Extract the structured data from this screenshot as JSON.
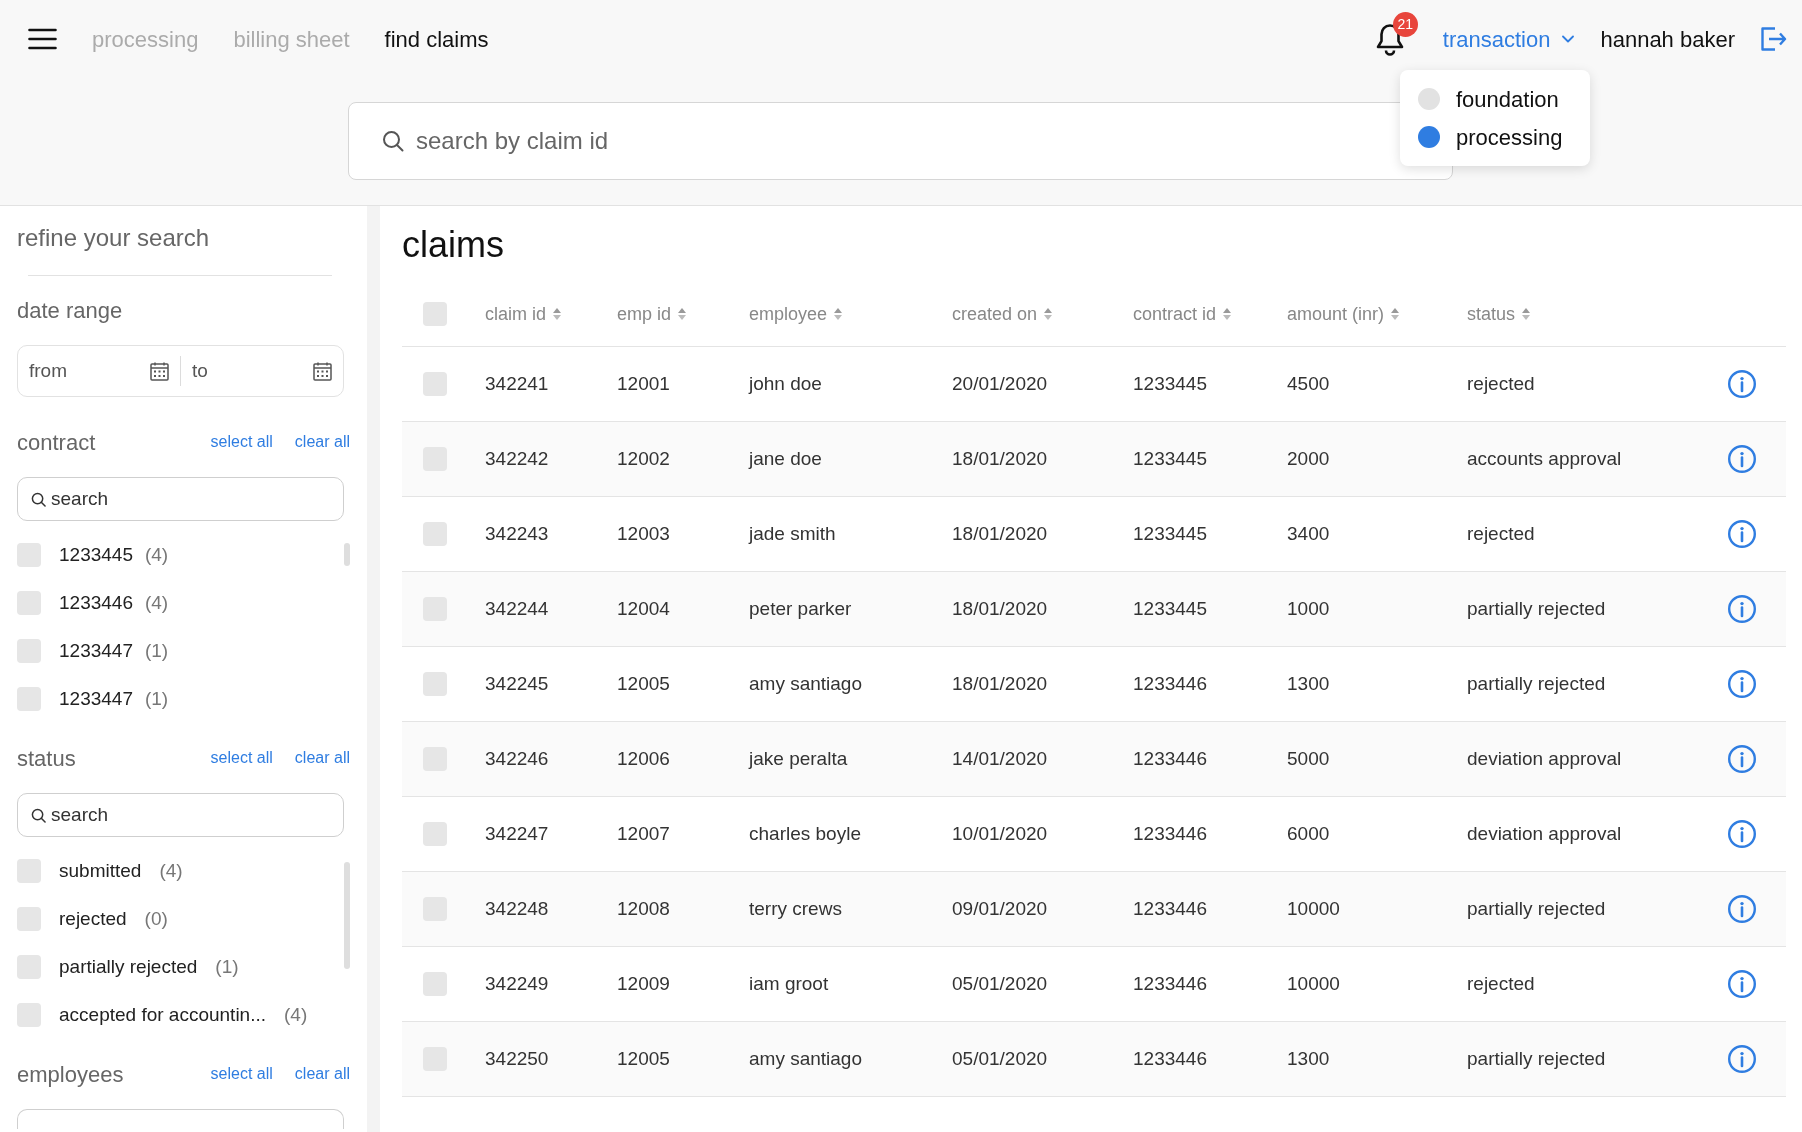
{
  "header": {
    "nav": [
      {
        "label": "processing",
        "selected": false
      },
      {
        "label": "billing sheet",
        "selected": false
      },
      {
        "label": "find claims",
        "selected": true
      }
    ],
    "notifications": {
      "count": "21"
    },
    "transaction_menu": {
      "label": "transaction",
      "expanded": true,
      "options": [
        {
          "label": "foundation",
          "selected": false
        },
        {
          "label": "processing",
          "selected": true
        }
      ]
    },
    "user": {
      "name": "hannah baker"
    }
  },
  "search": {
    "placeholder": "search by claim id"
  },
  "sidebar": {
    "title": "refine your search",
    "date_range": {
      "label": "date range",
      "from": {
        "placeholder": "from"
      },
      "to": {
        "placeholder": "to"
      }
    },
    "filters": [
      {
        "label": "contract",
        "select_all": "select all",
        "clear_all": "clear all",
        "search": {
          "placeholder": "search"
        },
        "options": [
          {
            "label": "1233445",
            "count": "(4)",
            "checked": false
          },
          {
            "label": "1233446",
            "count": "(4)",
            "checked": false
          },
          {
            "label": "1233447",
            "count": "(1)",
            "checked": false
          },
          {
            "label": "1233447",
            "count": "(1)",
            "checked": false
          }
        ]
      },
      {
        "label": "status",
        "select_all": "select all",
        "clear_all": "clear all",
        "search": {
          "placeholder": "search"
        },
        "options": [
          {
            "label": "submitted",
            "count": "(4)",
            "checked": false
          },
          {
            "label": "rejected",
            "count": "(0)",
            "checked": false
          },
          {
            "label": "partially rejected",
            "count": "(1)",
            "checked": false
          },
          {
            "label": "accepted for accountin...",
            "count": "(4)",
            "checked": false
          }
        ]
      },
      {
        "label": "employees",
        "select_all": "select all",
        "clear_all": "clear all"
      }
    ]
  },
  "table": {
    "title": "claims",
    "select_all_checked": false,
    "columns": [
      "claim id",
      "emp id",
      "employee",
      "created on",
      "contract id",
      "amount (inr)",
      "status"
    ],
    "rows": [
      {
        "checked": false,
        "cells": [
          "342241",
          "12001",
          "john doe",
          "20/01/2020",
          "1233445",
          "4500",
          "rejected"
        ]
      },
      {
        "checked": false,
        "cells": [
          "342242",
          "12002",
          "jane doe",
          "18/01/2020",
          "1233445",
          "2000",
          "accounts approval"
        ]
      },
      {
        "checked": false,
        "cells": [
          "342243",
          "12003",
          "jade smith",
          "18/01/2020",
          "1233445",
          "3400",
          "rejected"
        ]
      },
      {
        "checked": false,
        "cells": [
          "342244",
          "12004",
          "peter parker",
          "18/01/2020",
          "1233445",
          "1000",
          "partially rejected"
        ]
      },
      {
        "checked": false,
        "cells": [
          "342245",
          "12005",
          "amy santiago",
          "18/01/2020",
          "1233446",
          "1300",
          "partially rejected"
        ]
      },
      {
        "checked": false,
        "cells": [
          "342246",
          "12006",
          "jake peralta",
          "14/01/2020",
          "1233446",
          "5000",
          "deviation approval"
        ]
      },
      {
        "checked": false,
        "cells": [
          "342247",
          "12007",
          "charles boyle",
          "10/01/2020",
          "1233446",
          "6000",
          "deviation approval"
        ]
      },
      {
        "checked": false,
        "cells": [
          "342248",
          "12008",
          "terry crews",
          "09/01/2020",
          "1233446",
          "10000",
          "partially rejected"
        ]
      },
      {
        "checked": false,
        "cells": [
          "342249",
          "12009",
          "iam groot",
          "05/01/2020",
          "1233446",
          "10000",
          "rejected"
        ]
      },
      {
        "checked": false,
        "cells": [
          "342250",
          "12005",
          "amy santiago",
          "05/01/2020",
          "1233446",
          "1300",
          "partially rejected"
        ]
      }
    ]
  }
}
